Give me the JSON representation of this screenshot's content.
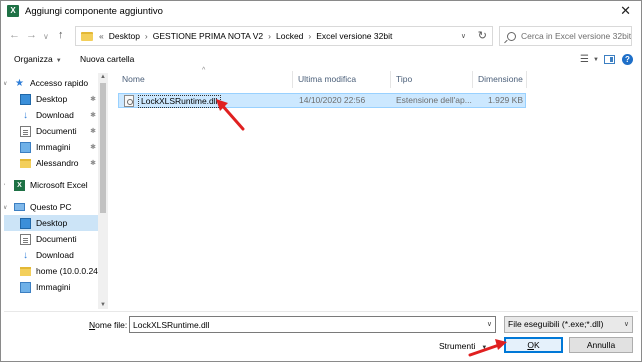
{
  "window": {
    "title": "Aggiungi componente aggiuntivo",
    "app_icon": "excel-icon",
    "close_glyph": "✕"
  },
  "navigation": {
    "back_glyph": "←",
    "forward_glyph": "→",
    "recent_glyph": "∨",
    "up_glyph": "↑",
    "prefix": "«",
    "breadcrumb": [
      "Desktop",
      "GESTIONE PRIMA NOTA V2",
      "Locked",
      "Excel versione 32bit"
    ],
    "separator": "›",
    "refresh_glyph": "↻"
  },
  "search": {
    "placeholder": "Cerca in Excel versione 32bit"
  },
  "toolbar": {
    "organize_label": "Organizza",
    "new_folder_label": "Nuova cartella",
    "help_glyph": "?"
  },
  "sidebar": {
    "items": [
      {
        "label": "Accesso rapido",
        "icon": "star-icon",
        "pinned": false
      },
      {
        "label": "Desktop",
        "icon": "desktop-icon",
        "pinned": true
      },
      {
        "label": "Download",
        "icon": "download-icon",
        "pinned": true
      },
      {
        "label": "Documenti",
        "icon": "documents-icon",
        "pinned": true
      },
      {
        "label": "Immagini",
        "icon": "pictures-icon",
        "pinned": true
      },
      {
        "label": "Alessandro",
        "icon": "folder-icon",
        "pinned": true
      },
      {
        "label": "Microsoft Excel",
        "icon": "excel-icon",
        "pinned": false
      },
      {
        "label": "Questo PC",
        "icon": "computer-icon",
        "pinned": false
      },
      {
        "label": "Desktop",
        "icon": "desktop-icon",
        "selected": true
      },
      {
        "label": "Documenti",
        "icon": "documents-icon"
      },
      {
        "label": "Download",
        "icon": "download-icon"
      },
      {
        "label": "home (10.0.0.245",
        "icon": "network-folder-icon"
      },
      {
        "label": "Immagini",
        "icon": "pictures-icon"
      }
    ],
    "pin_glyph": "📌"
  },
  "filelist": {
    "columns": [
      "Nome",
      "Ultima modifica",
      "Tipo",
      "Dimensione"
    ],
    "rows": [
      {
        "name": "LockXLSRuntime.dll",
        "modified": "14/10/2020 22:56",
        "type": "Estensione dell'ap...",
        "size": "1.929 KB",
        "selected": true
      }
    ]
  },
  "footer": {
    "filename_label_underlined": "N",
    "filename_label_rest": "ome file:",
    "filename_value": "LockXLSRuntime.dll",
    "filter_value": "File eseguibili (*.exe;*.dll)",
    "tools_label": "Strumenti",
    "ok_label_underlined": "O",
    "ok_label_rest": "K",
    "cancel_label": "Annulla"
  },
  "colors": {
    "selection_bg": "#cce8ff",
    "sidebar_selected_bg": "#cce4f7",
    "annotation_arrow": "#e02020",
    "ok_border": "#0078d7"
  }
}
